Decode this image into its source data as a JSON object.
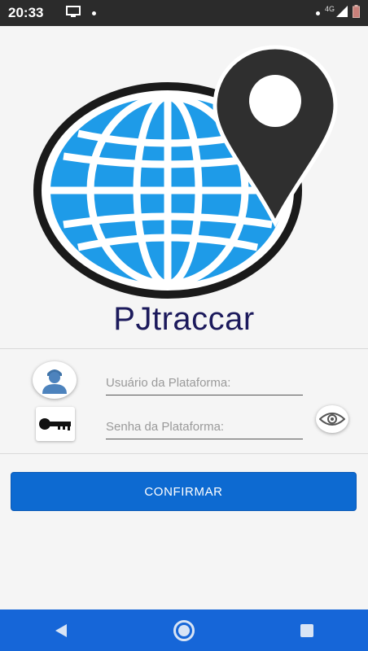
{
  "status_bar": {
    "time": "20:33",
    "network": "4G"
  },
  "app": {
    "title": "PJtraccar"
  },
  "form": {
    "username_placeholder": "Usuário da Plataforma:",
    "password_placeholder": "Senha da Plataforma:",
    "confirm_label": "CONFIRMAR"
  },
  "colors": {
    "globe": "#1e9be8",
    "accent": "#0d6ad1",
    "nav_bar": "#1666d8",
    "title": "#1c1a5c"
  },
  "icons": {
    "status": [
      "screen-cast-icon",
      "notification-dot-icon",
      "signal-icon",
      "battery-icon"
    ],
    "form": [
      "user-avatar-icon",
      "key-icon",
      "eye-icon"
    ],
    "nav": [
      "back-icon",
      "home-icon",
      "recents-icon"
    ]
  }
}
